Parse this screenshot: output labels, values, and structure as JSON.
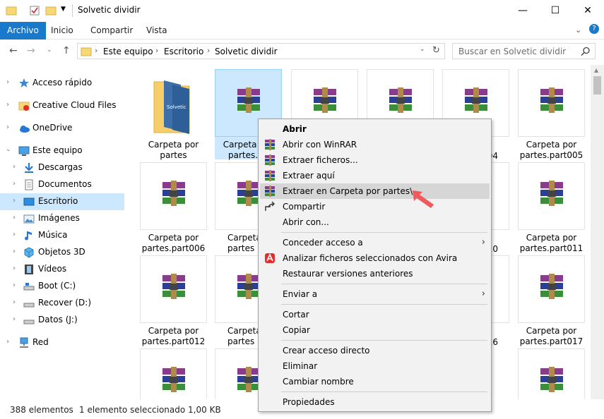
{
  "window": {
    "title": "Solvetic dividir"
  },
  "ribbon": {
    "tabs": [
      {
        "label": "Archivo",
        "active": true
      },
      {
        "label": "Inicio",
        "active": false
      },
      {
        "label": "Compartir",
        "active": false
      },
      {
        "label": "Vista",
        "active": false
      }
    ]
  },
  "address": {
    "crumbs": [
      "Este equipo",
      "Escritorio",
      "Solvetic dividir"
    ],
    "search_placeholder": "Buscar en Solvetic dividir"
  },
  "nav": {
    "items": [
      {
        "label": "Acceso rápido",
        "icon": "star-icon"
      },
      {
        "label": "Creative Cloud Files",
        "icon": "creative-cloud-icon"
      },
      {
        "label": "OneDrive",
        "icon": "cloud-icon"
      },
      {
        "label": "Este equipo",
        "icon": "computer-icon"
      },
      {
        "label": "Descargas",
        "icon": "download-icon"
      },
      {
        "label": "Documentos",
        "icon": "document-icon"
      },
      {
        "label": "Escritorio",
        "icon": "desktop-icon",
        "selected": true
      },
      {
        "label": "Imágenes",
        "icon": "image-icon"
      },
      {
        "label": "Música",
        "icon": "music-icon"
      },
      {
        "label": "Objetos 3D",
        "icon": "cube-icon"
      },
      {
        "label": "Vídeos",
        "icon": "video-icon"
      },
      {
        "label": "Boot (C:)",
        "icon": "drive-icon"
      },
      {
        "label": "Recover (D:)",
        "icon": "drive-icon"
      },
      {
        "label": "Datos (J:)",
        "icon": "drive-icon"
      },
      {
        "label": "Red",
        "icon": "network-icon"
      }
    ]
  },
  "files": {
    "row1": [
      "Carpeta por partes",
      "Carpeta por partes.pa",
      "",
      "",
      "004",
      "Carpeta por partes.part005"
    ],
    "row2": [
      "Carpeta por partes.part006",
      "Carpeta",
      "",
      "",
      "010",
      "Carpeta por partes.part011"
    ],
    "row3": [
      "Carpeta por partes.part012",
      "Carpeta",
      "",
      "",
      "016",
      "Carpeta por partes.part017"
    ],
    "label_line1": "Carpeta por",
    "f0_line2": "partes",
    "f1_line2": "partes.pa",
    "f5_line2": "partes.part005",
    "f6_line2": "partes.part006",
    "f7_line1": "Carpeta",
    "f7_line2": "partes",
    "f11_line2": "partes.part011",
    "f12_line2": "partes.part012",
    "f13_line1": "Carpeta",
    "f13_line2": "partes",
    "f17_line2": "partes.part017",
    "partial_004": "004",
    "partial_010": "010",
    "partial_016": "016"
  },
  "context_menu": {
    "open": "Abrir",
    "open_winrar": "Abrir con WinRAR",
    "extract_files": "Extraer ficheros...",
    "extract_here": "Extraer aquí",
    "extract_to": "Extraer en Carpeta por partes\\",
    "share": "Compartir",
    "open_with": "Abrir con...",
    "give_access": "Conceder acceso a",
    "avira": "Analizar ficheros seleccionados con Avira",
    "restore": "Restaurar versiones anteriores",
    "send_to": "Enviar a",
    "cut": "Cortar",
    "copy": "Copiar",
    "create_shortcut": "Crear acceso directo",
    "delete": "Eliminar",
    "rename": "Cambiar nombre",
    "properties": "Propiedades"
  },
  "status": {
    "count": "388 elementos",
    "selection": "1 elemento seleccionado  1,00 KB"
  },
  "colors": {
    "accent": "#1979ca",
    "selection": "#cce8ff",
    "pointer": "#f05a5a"
  }
}
